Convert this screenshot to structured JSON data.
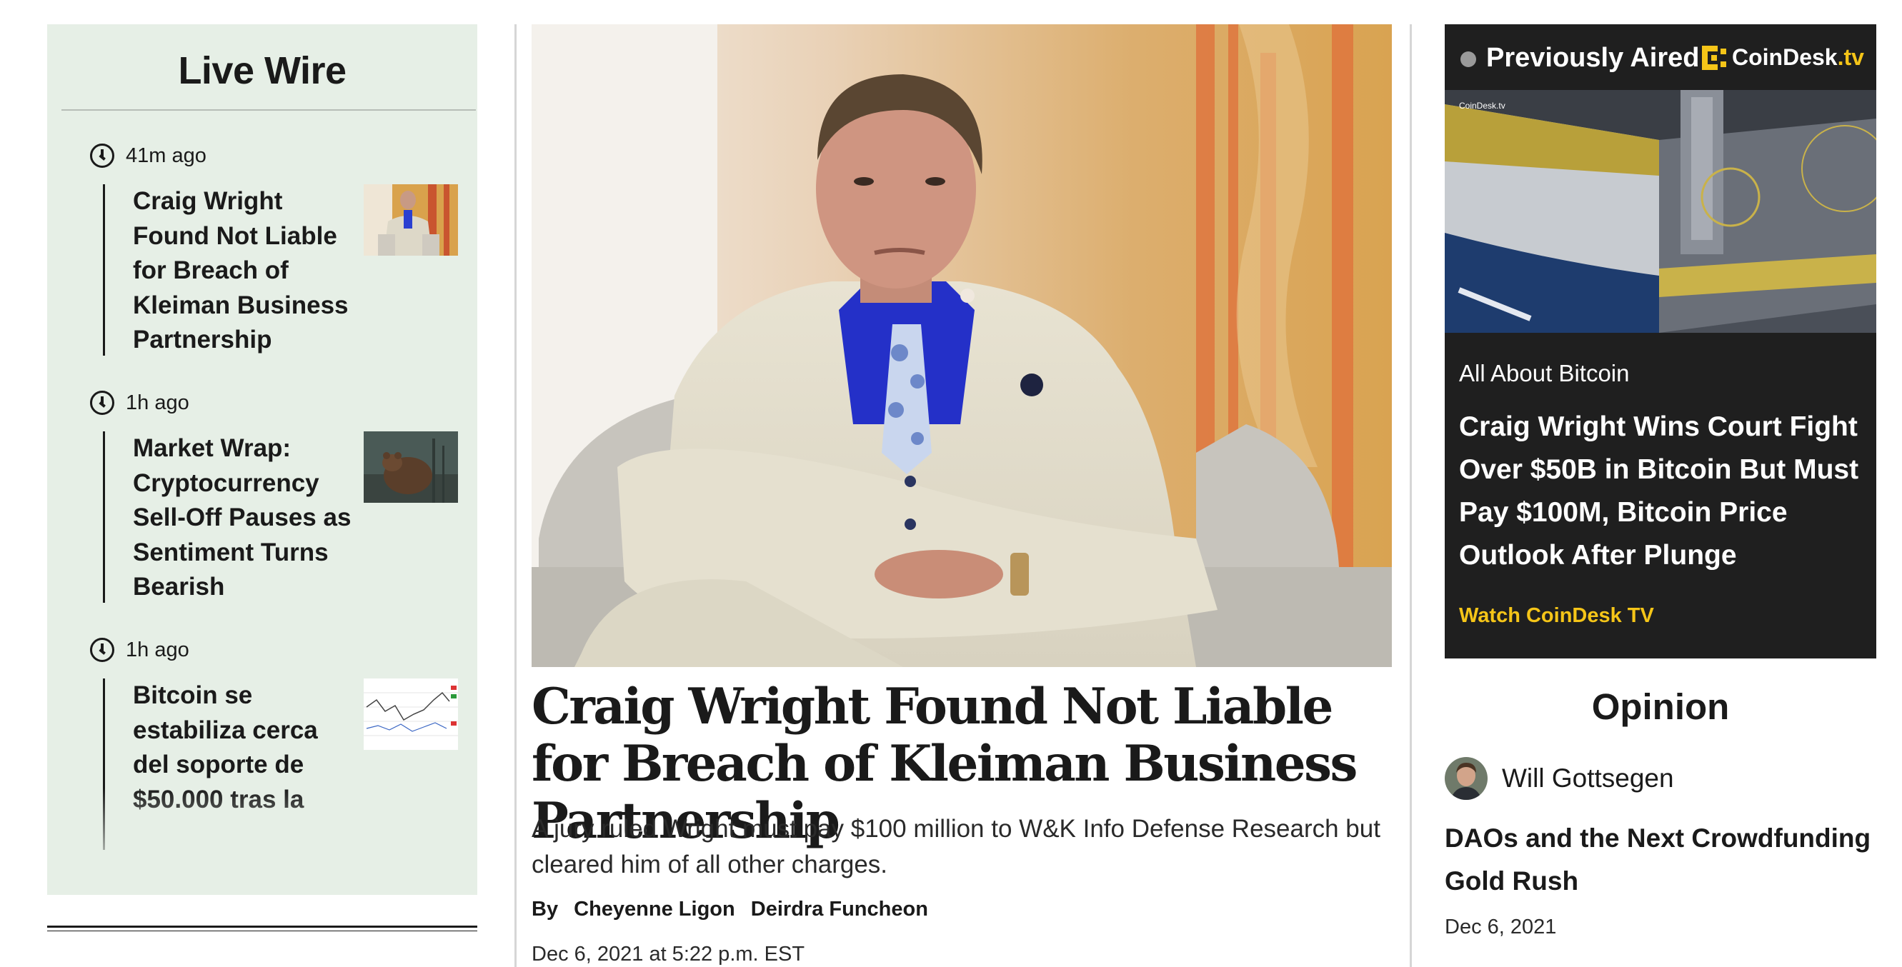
{
  "live_wire": {
    "title": "Live Wire",
    "items": [
      {
        "time": "41m ago",
        "headline": "Craig Wright Found Not Liable for Breach of Kleiman Business Partnership"
      },
      {
        "time": "1h ago",
        "headline": "Market Wrap: Cryptocurrency Sell-Off Pauses as Sentiment Turns Bearish"
      },
      {
        "time": "1h ago",
        "headline": "Bitcoin se estabiliza cerca del soporte de $50.000 tras la"
      }
    ]
  },
  "main_story": {
    "headline": "Craig Wright Found Not Liable for Breach of Kleiman Business Partnership",
    "dek": "A jury ruled Wright must pay $100 million to W&K Info Defense Research but cleared him of all other charges.",
    "byline_prefix": "By",
    "authors": [
      "Cheyenne Ligon",
      "Deirdra Funcheon"
    ],
    "date": "Dec 6, 2021 at 5:22 p.m. EST"
  },
  "tv": {
    "label": "Previously Aired",
    "brand": "CoinDesk",
    "brand_suffix": ".tv",
    "video_watermark": "CoinDesk.tv",
    "show": "All About Bitcoin",
    "title": "Craig Wright Wins Court Fight Over $50B in Bitcoin But Must Pay $100M, Bitcoin Price Outlook After Plunge",
    "cta": "Watch CoinDesk TV"
  },
  "opinion": {
    "title": "Opinion",
    "author": "Will Gottsegen",
    "headline": "DAOs and the Next Crowdfunding Gold Rush",
    "date": "Dec 6, 2021"
  },
  "colors": {
    "live_wire_bg": "#e6efe6",
    "tv_bg": "#1f1f1f",
    "accent_yellow": "#f5c518"
  }
}
